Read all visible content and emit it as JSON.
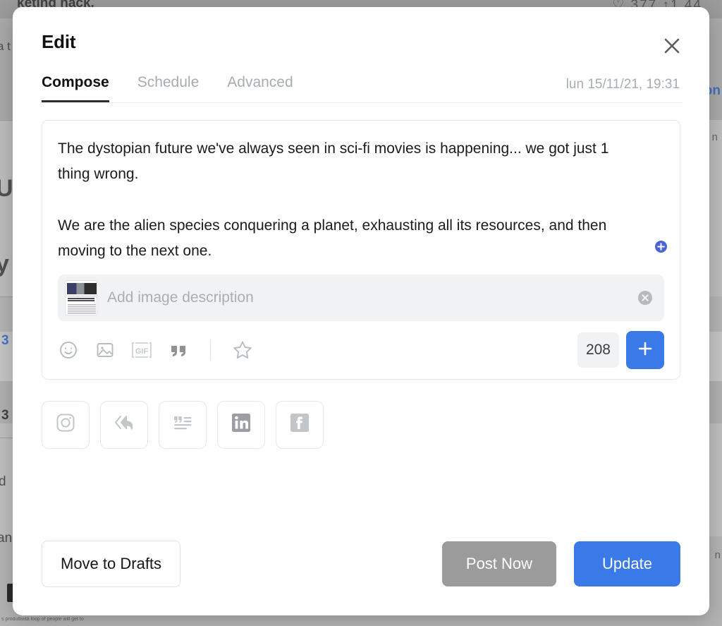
{
  "background": {
    "top_text": "keting hack.",
    "stats": "♡ 377  ↑1 44",
    "frag_left_1": "a t",
    "frag_left_2": "U",
    "frag_left_3": "y",
    "frag_left_4": "3",
    "frag_left_5": "3",
    "frag_left_6": "d",
    "frag_left_7": "an",
    "frag_right_1": "on",
    "frag_right_2": "n",
    "frag_right_3": "n",
    "tiny_text": "s produttività loop\nof people will get to"
  },
  "modal": {
    "title": "Edit",
    "close_icon": "close-icon",
    "tabs": [
      {
        "label": "Compose",
        "active": true
      },
      {
        "label": "Schedule",
        "active": false
      },
      {
        "label": "Advanced",
        "active": false
      }
    ],
    "date": "lun 15/11/21, 19:31"
  },
  "compose": {
    "text": "The dystopian future we've always seen in sci-fi movies is happening... we got just 1 thing wrong.\n\nWe are the alien species conquering a planet, exhausting all its resources, and then moving to the next one.",
    "inline_add_icon": "circle-plus-icon"
  },
  "attachment": {
    "thumbnail_name": "article-thumbnail",
    "placeholder": "Add image description",
    "value": "",
    "remove_icon": "remove-circle-icon"
  },
  "toolbar": {
    "items": [
      {
        "name": "emoji-icon",
        "label": "Emoji"
      },
      {
        "name": "image-icon",
        "label": "Image"
      },
      {
        "name": "gif-icon",
        "label": "GIF"
      },
      {
        "name": "quote-icon",
        "label": "Quote"
      },
      {
        "name": "star-icon",
        "label": "Star"
      }
    ],
    "char_count": "208",
    "add_label": "+"
  },
  "channels": [
    {
      "name": "instagram-icon",
      "label": "Instagram"
    },
    {
      "name": "thread-icon",
      "label": "Thread"
    },
    {
      "name": "blog-icon",
      "label": "Blog"
    },
    {
      "name": "linkedin-icon",
      "label": "LinkedIn"
    },
    {
      "name": "facebook-icon",
      "label": "Facebook"
    }
  ],
  "footer": {
    "drafts_label": "Move to Drafts",
    "post_now_label": "Post Now",
    "update_label": "Update"
  },
  "colors": {
    "accent_blue": "#3a7ae8",
    "post_now_gray": "#9b9b9b",
    "muted_text": "#a7acb1",
    "field_bg": "#f1f2f3"
  }
}
